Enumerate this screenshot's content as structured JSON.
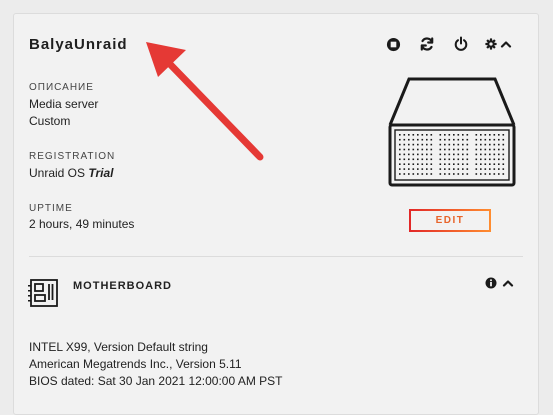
{
  "server": {
    "name": "BalyaUnraid",
    "description_label": "ОПИСАНИЕ",
    "description_line1": "Media server",
    "description_line2": "Custom",
    "registration_label": "REGISTRATION",
    "registration_prefix": "Unraid OS",
    "registration_type": "Trial",
    "uptime_label": "UPTIME",
    "uptime_value": "2 hours, 49 minutes",
    "edit_label": "EDIT"
  },
  "header_icons": [
    "stop-icon",
    "refresh-icon",
    "power-icon",
    "gear-icon",
    "chevron-up-icon"
  ],
  "motherboard": {
    "title": "MOTHERBOARD",
    "line1": "INTEL X99, Version Default string",
    "line2": "American Megatrends Inc., Version 5.11",
    "line3": "BIOS dated: Sat 30 Jan 2021 12:00:00 AM PST"
  },
  "colors": {
    "accent_red": "#e22828",
    "accent_orange": "#ff8c2f",
    "annotation_arrow": "#e53935"
  }
}
